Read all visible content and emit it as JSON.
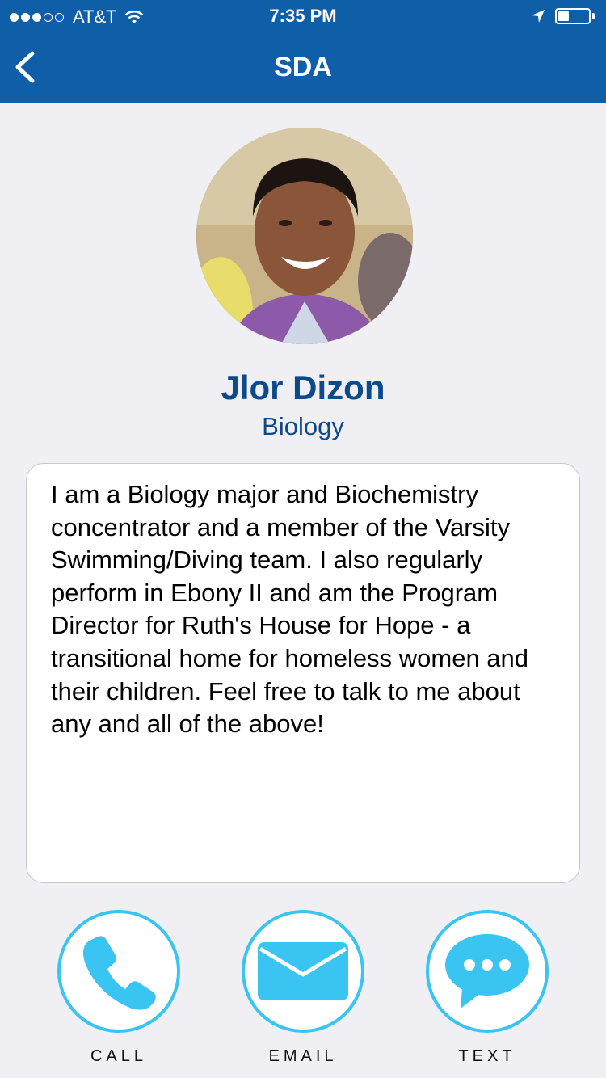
{
  "status_bar": {
    "carrier": "AT&T",
    "time": "7:35 PM",
    "signal_full": 3,
    "signal_total": 5,
    "battery_level": 0.35
  },
  "nav": {
    "title": "SDA",
    "back_icon": "chevron-left-icon"
  },
  "profile": {
    "name": "Jlor Dizon",
    "major": "Biology",
    "bio": "I am a Biology major and Biochemistry concentrator and a member of the Varsity Swimming/Diving team. I also regularly perform in Ebony II and am the Program Director for Ruth's House for Hope - a transitional home for homeless women and their children. Feel free to talk to me about any and all of the above!"
  },
  "actions": [
    {
      "label": "CALL",
      "icon": "phone-icon"
    },
    {
      "label": "EMAIL",
      "icon": "envelope-icon"
    },
    {
      "label": "TEXT",
      "icon": "chat-bubble-icon"
    }
  ],
  "colors": {
    "nav_bar": "#0f5ea8",
    "name_text": "#0d4a8b",
    "accent": "#39c4f2",
    "background": "#efeff4"
  }
}
